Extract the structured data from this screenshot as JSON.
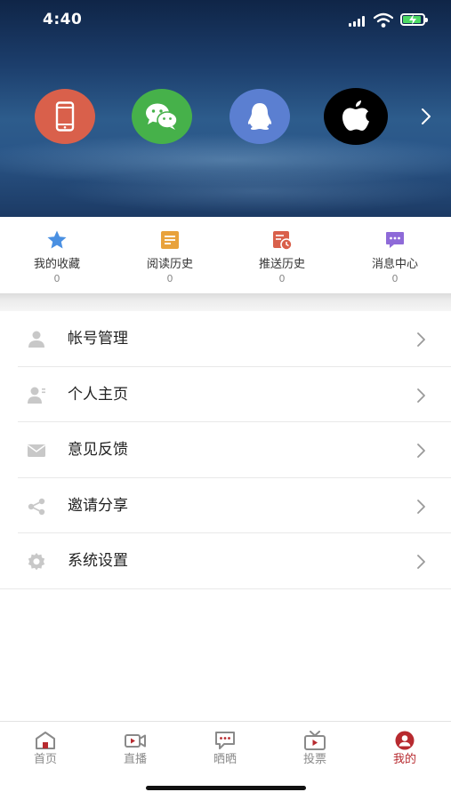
{
  "status_bar": {
    "time": "4:40"
  },
  "login_options": [
    {
      "name": "phone-login",
      "icon": "phone-icon",
      "color": "#d9604b"
    },
    {
      "name": "wechat-login",
      "icon": "wechat-icon",
      "color": "#46b14a"
    },
    {
      "name": "qq-login",
      "icon": "qq-icon",
      "color": "#5b7fd1"
    },
    {
      "name": "apple-login",
      "icon": "apple-icon",
      "color": "#000000"
    }
  ],
  "quick_actions": [
    {
      "label": "我的收藏",
      "count": "0",
      "icon": "star-icon",
      "color": "#4a90e2"
    },
    {
      "label": "阅读历史",
      "count": "0",
      "icon": "document-icon",
      "color": "#e8a23c"
    },
    {
      "label": "推送历史",
      "count": "0",
      "icon": "calendar-clock-icon",
      "color": "#d9604b"
    },
    {
      "label": "消息中心",
      "count": "0",
      "icon": "chat-bubble-icon",
      "color": "#8e6ad8"
    }
  ],
  "menu": [
    {
      "label": "帐号管理",
      "icon": "user-icon"
    },
    {
      "label": "个人主页",
      "icon": "profile-icon"
    },
    {
      "label": "意见反馈",
      "icon": "mail-icon"
    },
    {
      "label": "邀请分享",
      "icon": "share-icon"
    },
    {
      "label": "系统设置",
      "icon": "gear-icon"
    }
  ],
  "tabs": [
    {
      "label": "首页",
      "icon": "home-icon",
      "active": false
    },
    {
      "label": "直播",
      "icon": "video-camera-icon",
      "active": false
    },
    {
      "label": "晒晒",
      "icon": "chat-icon",
      "active": false
    },
    {
      "label": "投票",
      "icon": "tv-icon",
      "active": false
    },
    {
      "label": "我的",
      "icon": "person-icon",
      "active": true
    }
  ],
  "colors": {
    "accent": "#b72a2f",
    "tab_inactive": "#8a8a8a"
  }
}
